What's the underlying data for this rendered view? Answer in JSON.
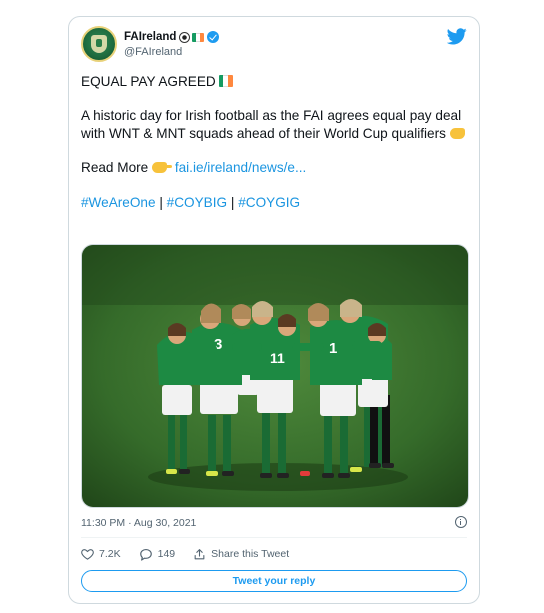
{
  "tweet": {
    "display_name": "FAIreland",
    "handle": "@FAIreland",
    "headline": "EQUAL PAY AGREED",
    "body": "A historic day for Irish football as the FAI agrees equal pay deal with WNT & MNT squads ahead of their World Cup qualifiers",
    "read_more_label": "Read More",
    "link_text": "fai.ie/ireland/news/e...",
    "hashtags": [
      "#WeAreOne",
      "#COYBIG",
      "#COYGIG"
    ],
    "hashtag_separator": "|",
    "timestamp": "11:30 PM · Aug 30, 2021"
  },
  "actions": {
    "like_count": "7.2K",
    "reply_count": "149",
    "share_label": "Share this Tweet",
    "reply_button_label": "Tweet your reply"
  },
  "icons": {
    "brand": "twitter-bird-icon",
    "verified": "verified-badge-icon",
    "like": "heart-icon",
    "reply": "speech-bubble-icon",
    "share": "share-icon",
    "info": "info-icon"
  },
  "colors": {
    "accent": "#1d9bf0",
    "link": "#1b95e0",
    "text": "#0f1419",
    "muted": "#536471",
    "border": "#cfd9de",
    "ireland_green": "#169b62",
    "ireland_orange": "#ff883e"
  }
}
